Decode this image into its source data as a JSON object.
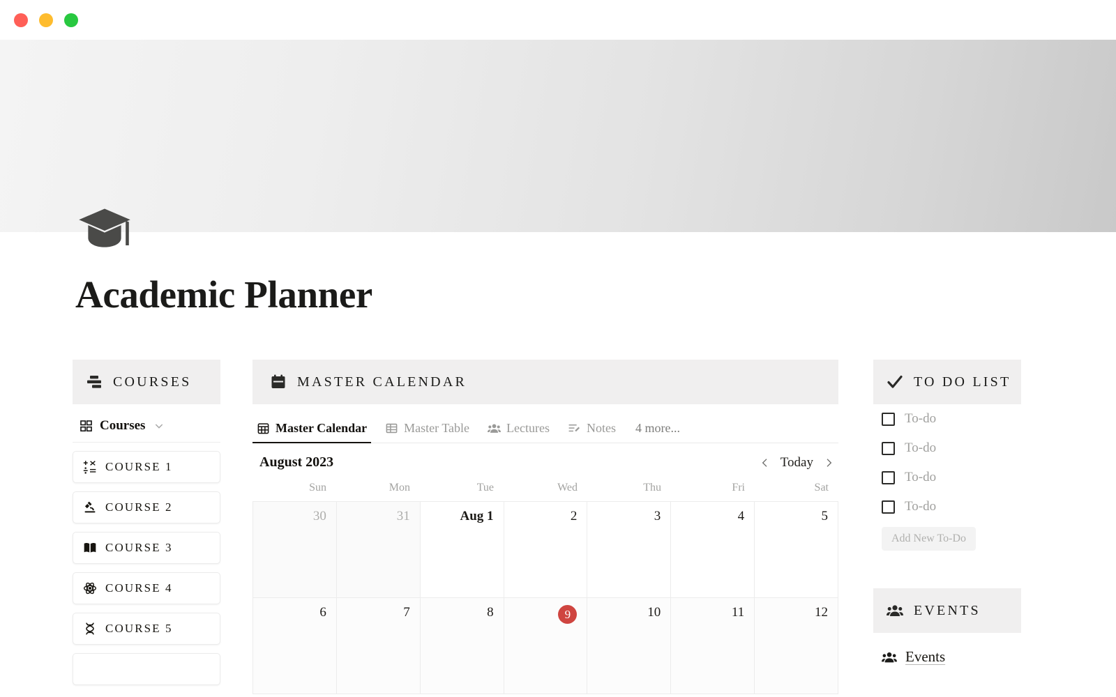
{
  "window": {
    "controls": [
      {
        "name": "close",
        "color": "#ff5f57"
      },
      {
        "name": "minimize",
        "color": "#febc2e"
      },
      {
        "name": "maximize",
        "color": "#28c840"
      }
    ]
  },
  "page": {
    "icon": "graduation-cap-icon",
    "title": "Academic Planner"
  },
  "courses_panel": {
    "header": {
      "icon": "list-bars-icon",
      "label": "COURSES"
    },
    "database": {
      "icon": "grid-four-icon",
      "label": "Courses",
      "chevron": "chevron-down-icon"
    },
    "items": [
      {
        "icon": "math-symbols-icon",
        "label": "COURSE 1"
      },
      {
        "icon": "microscope-icon",
        "label": "COURSE 2"
      },
      {
        "icon": "open-book-icon",
        "label": "COURSE 3"
      },
      {
        "icon": "atom-icon",
        "label": "COURSE 4"
      },
      {
        "icon": "dna-icon",
        "label": "COURSE 5"
      },
      {
        "icon": "course-icon",
        "label": ""
      }
    ]
  },
  "calendar_panel": {
    "header": {
      "icon": "calendar-icon",
      "label": "MASTER CALENDAR"
    },
    "tabs": [
      {
        "icon": "calendar-grid-icon",
        "label": "Master Calendar",
        "active": true
      },
      {
        "icon": "table-icon",
        "label": "Master Table",
        "active": false
      },
      {
        "icon": "people-icon",
        "label": "Lectures",
        "active": false
      },
      {
        "icon": "note-edit-icon",
        "label": "Notes",
        "active": false
      }
    ],
    "more_tabs_label": "4 more...",
    "toolbar": {
      "month": "August 2023",
      "prev_icon": "chevron-left-icon",
      "today_label": "Today",
      "next_icon": "chevron-right-icon"
    },
    "day_names": [
      "Sun",
      "Mon",
      "Tue",
      "Wed",
      "Thu",
      "Fri",
      "Sat"
    ],
    "weeks": [
      [
        {
          "label": "30",
          "outside": true,
          "bold": false,
          "today": false
        },
        {
          "label": "31",
          "outside": true,
          "bold": false,
          "today": false
        },
        {
          "label": "Aug 1",
          "outside": false,
          "bold": true,
          "today": false
        },
        {
          "label": "2",
          "outside": false,
          "bold": false,
          "today": false
        },
        {
          "label": "3",
          "outside": false,
          "bold": false,
          "today": false
        },
        {
          "label": "4",
          "outside": false,
          "bold": false,
          "today": false
        },
        {
          "label": "5",
          "outside": false,
          "bold": false,
          "today": false
        }
      ],
      [
        {
          "label": "6",
          "outside": false,
          "bold": false,
          "today": false
        },
        {
          "label": "7",
          "outside": false,
          "bold": false,
          "today": false
        },
        {
          "label": "8",
          "outside": false,
          "bold": false,
          "today": false
        },
        {
          "label": "9",
          "outside": false,
          "bold": false,
          "today": true
        },
        {
          "label": "10",
          "outside": false,
          "bold": false,
          "today": false
        },
        {
          "label": "11",
          "outside": false,
          "bold": false,
          "today": false
        },
        {
          "label": "12",
          "outside": false,
          "bold": false,
          "today": false
        }
      ]
    ],
    "today_accent": "#cf4540"
  },
  "todo_panel": {
    "header": {
      "icon": "checkmark-icon",
      "label": "TO DO LIST"
    },
    "items": [
      {
        "label": "To-do",
        "checked": false
      },
      {
        "label": "To-do",
        "checked": false
      },
      {
        "label": "To-do",
        "checked": false
      },
      {
        "label": "To-do",
        "checked": false
      }
    ],
    "add_label": "Add New To-Do"
  },
  "events_panel": {
    "header": {
      "icon": "people-icon",
      "label": "EVENTS"
    },
    "link": {
      "icon": "people-icon",
      "label": "Events"
    }
  }
}
